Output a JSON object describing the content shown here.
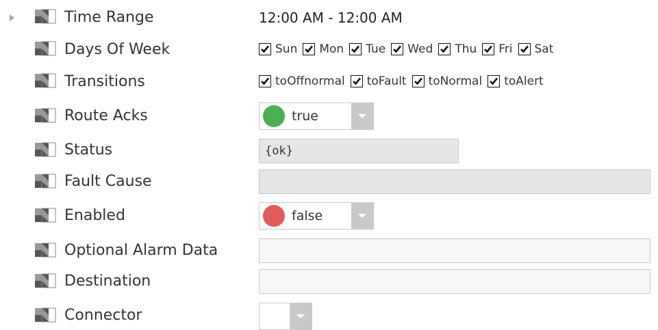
{
  "properties": [
    {
      "id": "time-range",
      "label": "Time Range",
      "value": "12:00 AM - 12:00 AM"
    },
    {
      "id": "days-of-week",
      "label": "Days Of Week",
      "options": [
        {
          "label": "Sun",
          "checked": true
        },
        {
          "label": "Mon",
          "checked": true
        },
        {
          "label": "Tue",
          "checked": true
        },
        {
          "label": "Wed",
          "checked": true
        },
        {
          "label": "Thu",
          "checked": true
        },
        {
          "label": "Fri",
          "checked": true
        },
        {
          "label": "Sat",
          "checked": true
        }
      ]
    },
    {
      "id": "transitions",
      "label": "Transitions",
      "options": [
        {
          "label": "toOffnormal",
          "checked": true
        },
        {
          "label": "toFault",
          "checked": true
        },
        {
          "label": "toNormal",
          "checked": true
        },
        {
          "label": "toAlert",
          "checked": true
        }
      ]
    },
    {
      "id": "route-acks",
      "label": "Route Acks",
      "value": "true",
      "indicator_color": "#4caf50"
    },
    {
      "id": "status",
      "label": "Status",
      "value": "{ok}"
    },
    {
      "id": "fault-cause",
      "label": "Fault Cause",
      "value": ""
    },
    {
      "id": "enabled",
      "label": "Enabled",
      "value": "false",
      "indicator_color": "#e25b5b"
    },
    {
      "id": "optional-alarm-data",
      "label": "Optional Alarm Data",
      "value": ""
    },
    {
      "id": "destination",
      "label": "Destination",
      "value": ""
    },
    {
      "id": "connector",
      "label": "Connector",
      "value": ""
    }
  ],
  "icons": {
    "property": "property-slot-icon",
    "expander": "expand-arrow-icon",
    "checkbox": "checkbox-checked-icon",
    "dropdown": "chevron-down-icon"
  },
  "colors": {
    "dropdown_arrow_bg": "#c9c9c9",
    "readonly_field_bg": "#e6e6e6",
    "editable_field_bg": "#f7f7f7"
  }
}
